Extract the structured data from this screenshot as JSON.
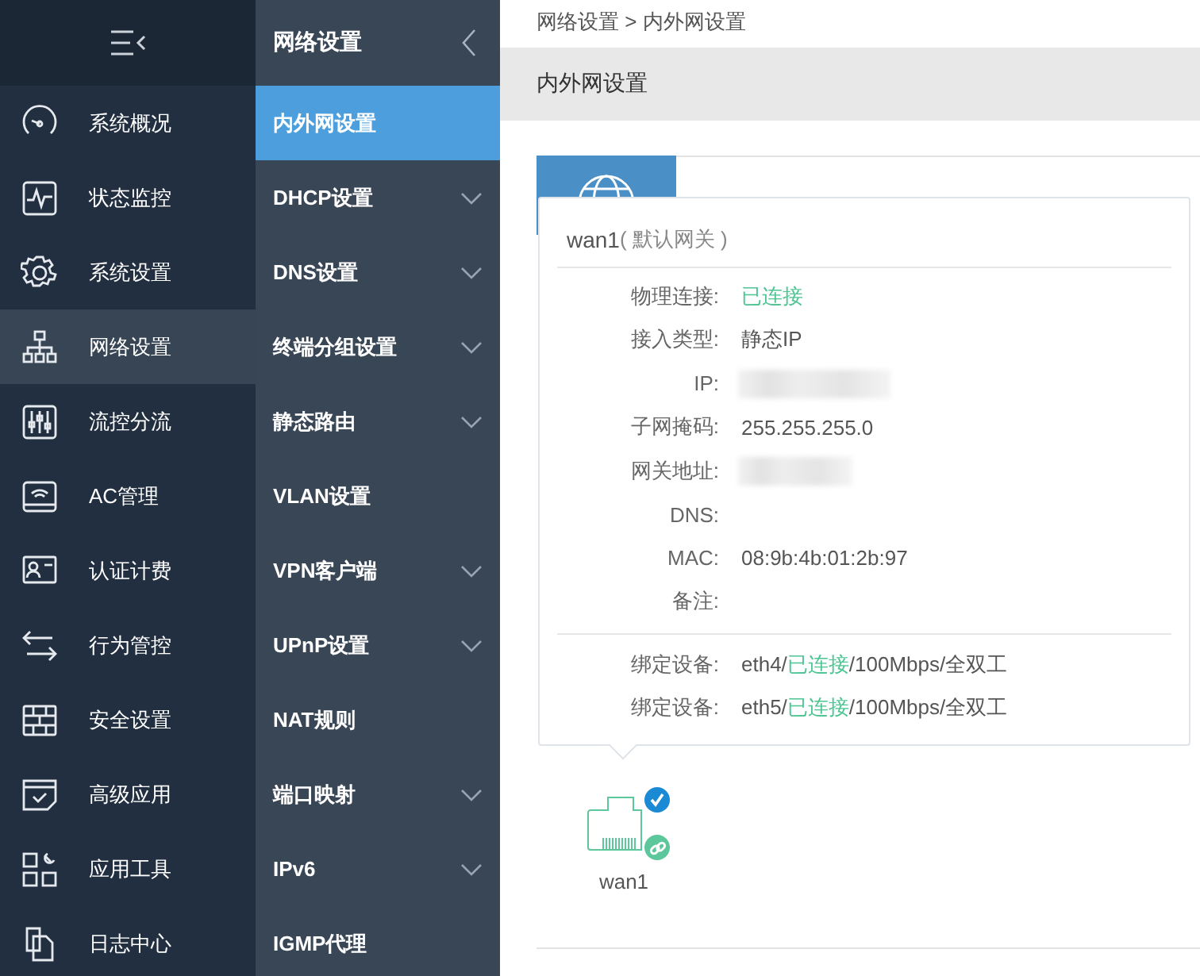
{
  "nav": {
    "items": [
      {
        "label": "系统概况",
        "selected": false
      },
      {
        "label": "状态监控",
        "selected": false
      },
      {
        "label": "系统设置",
        "selected": false
      },
      {
        "label": "网络设置",
        "selected": true
      },
      {
        "label": "流控分流",
        "selected": false
      },
      {
        "label": "AC管理",
        "selected": false
      },
      {
        "label": "认证计费",
        "selected": false
      },
      {
        "label": "行为管控",
        "selected": false
      },
      {
        "label": "安全设置",
        "selected": false
      },
      {
        "label": "高级应用",
        "selected": false
      },
      {
        "label": "应用工具",
        "selected": false
      },
      {
        "label": "日志中心",
        "selected": false
      }
    ]
  },
  "subnav": {
    "title": "网络设置",
    "items": [
      {
        "label": "内外网设置",
        "selected": true,
        "has_submenu": false
      },
      {
        "label": "DHCP设置",
        "selected": false,
        "has_submenu": true
      },
      {
        "label": "DNS设置",
        "selected": false,
        "has_submenu": true
      },
      {
        "label": "终端分组设置",
        "selected": false,
        "has_submenu": true
      },
      {
        "label": "静态路由",
        "selected": false,
        "has_submenu": true
      },
      {
        "label": "VLAN设置",
        "selected": false,
        "has_submenu": false
      },
      {
        "label": "VPN客户端",
        "selected": false,
        "has_submenu": true
      },
      {
        "label": "UPnP设置",
        "selected": false,
        "has_submenu": true
      },
      {
        "label": "NAT规则",
        "selected": false,
        "has_submenu": false
      },
      {
        "label": "端口映射",
        "selected": false,
        "has_submenu": true
      },
      {
        "label": "IPv6",
        "selected": false,
        "has_submenu": true
      },
      {
        "label": "IGMP代理",
        "selected": false,
        "has_submenu": false
      }
    ]
  },
  "breadcrumb": "网络设置 > 内外网设置",
  "page_title": "内外网设置",
  "popover": {
    "name": "wan1",
    "note": "( 默认网关 )",
    "rows": [
      {
        "label": "物理连接:",
        "kind": "status",
        "value": "已连接"
      },
      {
        "label": "接入类型:",
        "kind": "text",
        "value": "静态IP"
      },
      {
        "label": "IP:",
        "kind": "redacted"
      },
      {
        "label": "子网掩码:",
        "kind": "text",
        "value": "255.255.255.0"
      },
      {
        "label": "网关地址:",
        "kind": "redacted"
      },
      {
        "label": "DNS:",
        "kind": "empty"
      },
      {
        "label": "MAC:",
        "kind": "text",
        "value": "08:9b:4b:01:2b:97"
      },
      {
        "label": "备注:",
        "kind": "empty"
      }
    ],
    "bindings": [
      {
        "label": "绑定设备:",
        "parts": [
          {
            "kind": "plain",
            "text": "eth4/"
          },
          {
            "kind": "status",
            "text": "已连接"
          },
          {
            "kind": "plain",
            "text": "/100Mbps/全双工"
          }
        ]
      },
      {
        "label": "绑定设备:",
        "parts": [
          {
            "kind": "plain",
            "text": "eth5/"
          },
          {
            "kind": "status",
            "text": "已连接"
          },
          {
            "kind": "plain",
            "text": "/100Mbps/全双工"
          }
        ]
      }
    ]
  },
  "device": {
    "label": "wan1",
    "checked": true,
    "linked": true
  }
}
